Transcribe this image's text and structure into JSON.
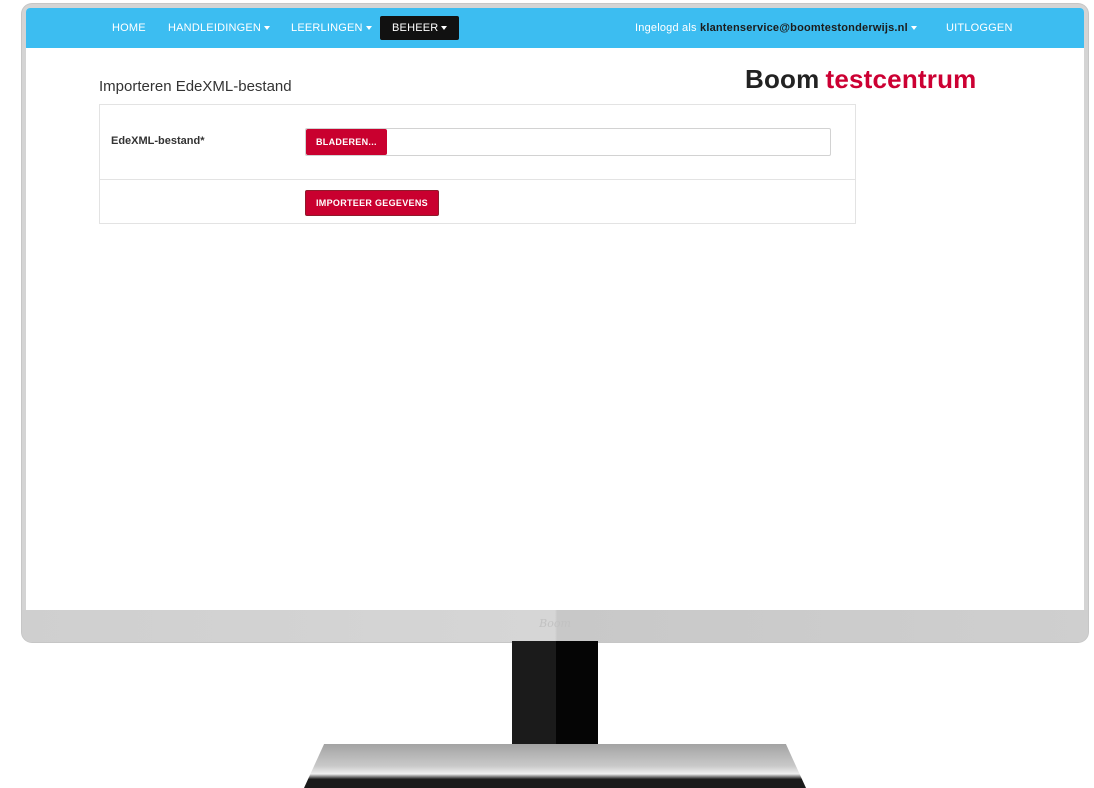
{
  "nav": {
    "home": "HOME",
    "handleidingen": "HANDLEIDINGEN",
    "leerlingen": "LEERLINGEN",
    "beheer": "BEHEER",
    "user_prefix": "Ingelogd als",
    "user_email": "klantenservice@boomtestonderwijs.nl",
    "logout": "UITLOGGEN"
  },
  "page": {
    "title": "Importeren EdeXML-bestand"
  },
  "logo": {
    "part1": "Boom",
    "part2": "testcentrum"
  },
  "form": {
    "file_label": "EdeXML-bestand*",
    "browse_button": "BLADEREN...",
    "file_value": "",
    "submit_button": "IMPORTEER GEGEVENS"
  },
  "monitor": {
    "brand": "Boom"
  },
  "colors": {
    "navbar": "#3cbdf1",
    "active_tab": "#111111",
    "accent_red": "#c9002f",
    "logo_red": "#cc0033"
  }
}
